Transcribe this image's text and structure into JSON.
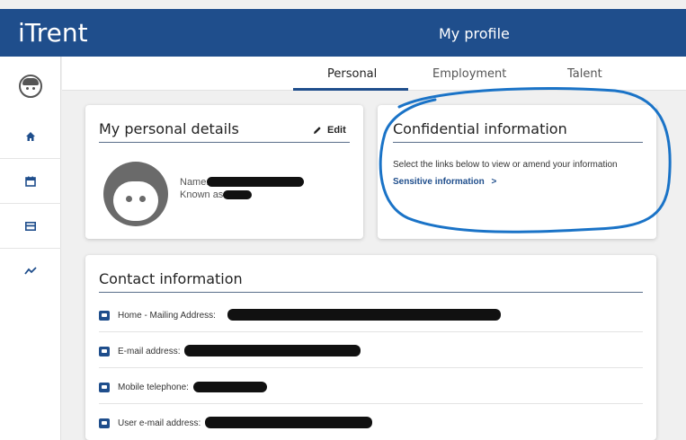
{
  "app": {
    "brand": "iTrent",
    "page_title": "My profile"
  },
  "sidebar": {
    "items": [
      {
        "icon": "user-avatar-icon"
      },
      {
        "icon": "home-icon"
      },
      {
        "icon": "calendar-icon"
      },
      {
        "icon": "card-icon"
      },
      {
        "icon": "trend-chart-icon"
      }
    ]
  },
  "tabs": [
    {
      "label": "Personal",
      "active": true
    },
    {
      "label": "Employment",
      "active": false
    },
    {
      "label": "Talent",
      "active": false
    }
  ],
  "personal_details": {
    "title": "My personal details",
    "edit_label": "Edit",
    "fields": [
      {
        "label": "Name:"
      },
      {
        "label": "Known as:"
      }
    ]
  },
  "confidential": {
    "title": "Confidential information",
    "description": "Select the links below to view or amend your information",
    "link_label": "Sensitive information",
    "link_chevron": ">"
  },
  "contact": {
    "title": "Contact information",
    "rows": [
      {
        "label": "Home - Mailing Address:",
        "icon": "address-card-icon"
      },
      {
        "label": "E-mail address:",
        "icon": "contact-badge-icon"
      },
      {
        "label": "Mobile telephone:",
        "icon": "contact-badge-icon"
      },
      {
        "label": "User e-mail address:",
        "icon": "contact-badge-icon"
      }
    ]
  },
  "colors": {
    "brand": "#1f4e8c",
    "annotation": "#1a73c7"
  }
}
